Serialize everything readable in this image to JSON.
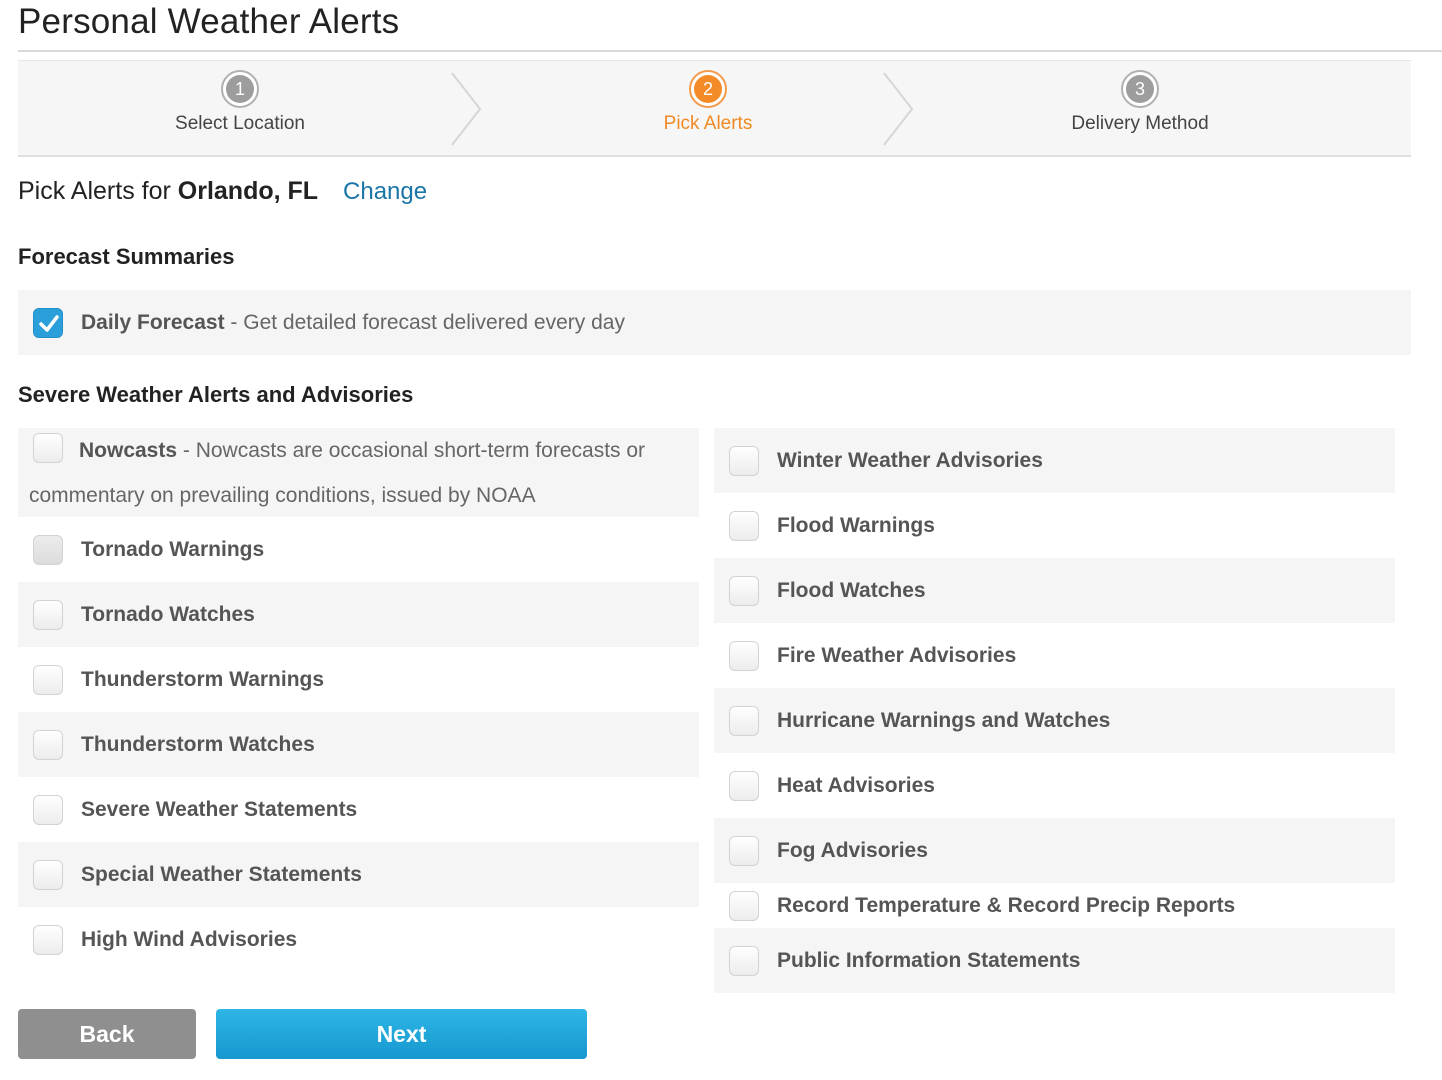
{
  "page": {
    "title": "Personal Weather Alerts"
  },
  "steps": [
    {
      "number": "1",
      "label": "Select Location",
      "state": "done"
    },
    {
      "number": "2",
      "label": "Pick Alerts",
      "state": "active"
    },
    {
      "number": "3",
      "label": "Delivery Method",
      "state": "pending"
    }
  ],
  "colors": {
    "accent_orange": "#f48b29",
    "link_blue": "#1a75a8",
    "checkbox_checked": "#2a9fd9",
    "next_button": "#1798cf",
    "back_button": "#8f8f8f"
  },
  "pick": {
    "prefix": "Pick Alerts for",
    "location": "Orlando, FL",
    "change_link": "Change"
  },
  "forecast": {
    "heading": "Forecast Summaries",
    "daily": {
      "name": "Daily Forecast",
      "desc": " - Get detailed forecast delivered every day",
      "checked": true
    }
  },
  "severe": {
    "heading": "Severe Weather Alerts and Advisories",
    "nowcasts": {
      "name": "Nowcasts",
      "desc": " - Nowcasts are occasional short-term forecasts or commentary on prevailing conditions, issued by NOAA",
      "checked": false
    },
    "left": [
      {
        "label": "Tornado Warnings",
        "checked": false
      },
      {
        "label": "Tornado Watches",
        "checked": false
      },
      {
        "label": "Thunderstorm Warnings",
        "checked": false
      },
      {
        "label": "Thunderstorm Watches",
        "checked": false
      },
      {
        "label": "Severe Weather Statements",
        "checked": false
      },
      {
        "label": "Special Weather Statements",
        "checked": false
      },
      {
        "label": "High Wind Advisories",
        "checked": false
      }
    ],
    "right": [
      {
        "label": "Winter Weather Advisories",
        "checked": false
      },
      {
        "label": "Flood Warnings",
        "checked": false
      },
      {
        "label": "Flood Watches",
        "checked": false
      },
      {
        "label": "Fire Weather Advisories",
        "checked": false
      },
      {
        "label": "Hurricane Warnings and Watches",
        "checked": false
      },
      {
        "label": "Heat Advisories",
        "checked": false
      },
      {
        "label": "Fog Advisories",
        "checked": false
      },
      {
        "label": "Record Temperature & Record Precip Reports",
        "checked": false
      },
      {
        "label": "Public Information Statements",
        "checked": false
      }
    ]
  },
  "buttons": {
    "back": "Back",
    "next": "Next"
  }
}
